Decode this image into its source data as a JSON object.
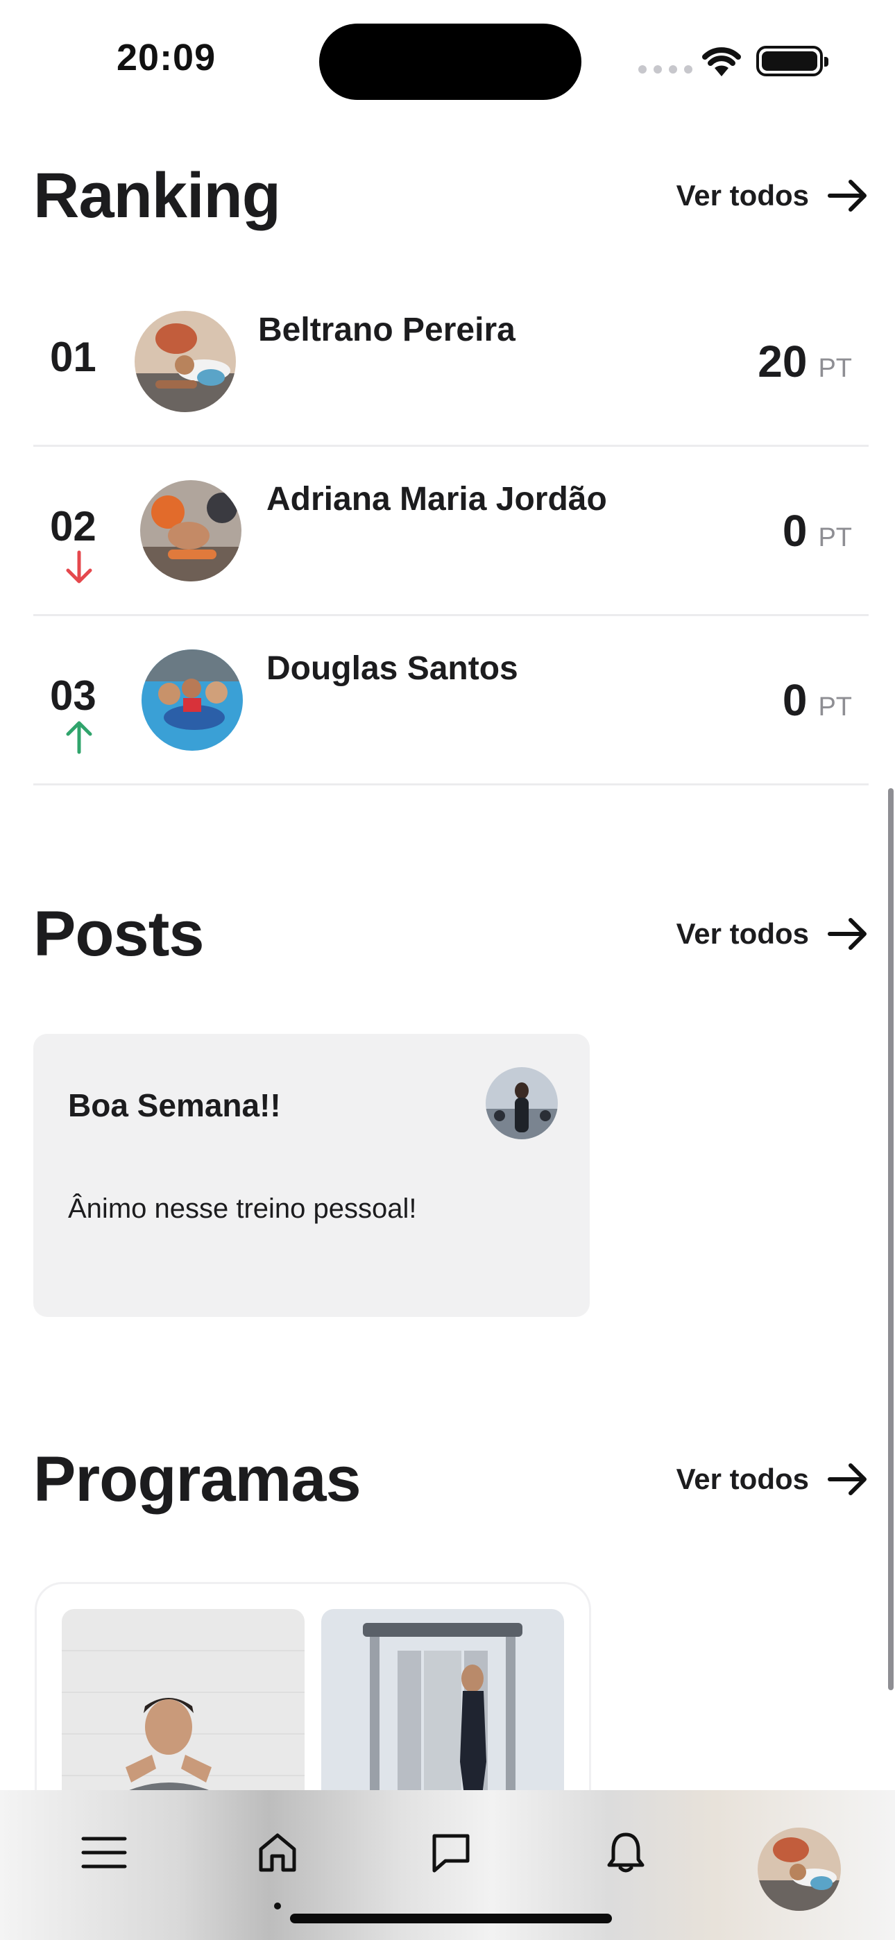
{
  "status_bar": {
    "time": "20:09"
  },
  "ranking": {
    "title": "Ranking",
    "see_all": "Ver todos",
    "items": [
      {
        "position": "01",
        "name": "Beltrano Pereira",
        "score": "20",
        "unit": "PT",
        "trend": "none"
      },
      {
        "position": "02",
        "name": "Adriana Maria Jordão",
        "score": "0",
        "unit": "PT",
        "trend": "down"
      },
      {
        "position": "03",
        "name": "Douglas Santos",
        "score": "0",
        "unit": "PT",
        "trend": "up"
      }
    ]
  },
  "posts": {
    "title": "Posts",
    "see_all": "Ver todos",
    "items": [
      {
        "title": "Boa Semana!!",
        "body": "Ânimo nesse treino pessoal!"
      }
    ]
  },
  "programs": {
    "title": "Programas",
    "see_all": "Ver todos"
  },
  "tab_bar": {
    "items": [
      "menu-icon",
      "home-icon",
      "chat-icon",
      "bell-icon",
      "profile-avatar"
    ],
    "active": "home-icon"
  },
  "colors": {
    "trend_down": "#e5484d",
    "trend_up": "#30a46c",
    "card_background": "#f1f1f2",
    "text_primary": "#1c1c1e",
    "text_secondary": "#8e8e93"
  }
}
